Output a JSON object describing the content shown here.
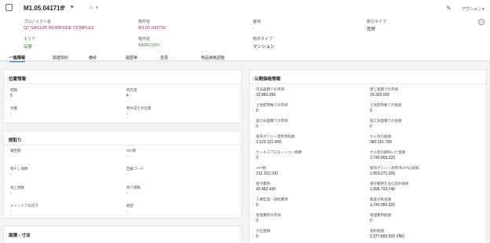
{
  "header": {
    "record_icon": "cube-icon",
    "title": "M1.05.041716",
    "favorite_icon": "star-icon",
    "flag_icon": "flag-icon",
    "tag_icon": "tag-icon",
    "tag_caret": "▾",
    "edit_icon": "pencil-icon",
    "actions_label": "アクション",
    "actions_caret": "▾",
    "feedback_icon": "smiley-icon"
  },
  "summary": {
    "project_label": "プロジェクト名",
    "project_value": "Q7 SAIGON RIVERSIDE COMPLEX",
    "unit_label": "物件名",
    "unit_value": "M1.05.041716",
    "number_label": "番地",
    "number_value": "-",
    "sale_type_label": "数引タイプ",
    "sale_type_value": "売買",
    "area_label": "エリア",
    "area_value": "高層",
    "building_label": "物件名",
    "building_value": "MERCURY",
    "property_type_label": "物件タイプ",
    "property_type_value": "マンション"
  },
  "tabs": [
    {
      "label": "一般情報",
      "active": true
    },
    {
      "label": "関連契約",
      "active": false
    },
    {
      "label": "備考",
      "active": false
    },
    {
      "label": "履歴等",
      "active": false
    },
    {
      "label": "変更",
      "active": false
    },
    {
      "label": "物品価格調整",
      "active": false
    }
  ],
  "location": {
    "title": "位置情報",
    "floor_label": "階数",
    "floor_value": "5",
    "floor_pos_label": "所在階",
    "floor_pos_value": "4",
    "lot_label": "地番",
    "lot_value": "-",
    "position_label": "物件該土の位置",
    "position_value": "-"
  },
  "layout": {
    "title": "間取り",
    "bedroom_label": "寝室数",
    "bedroom_value": "-",
    "wc_label": "WC数",
    "wc_value": "-",
    "closet_label": "物干し場数",
    "closet_value": "-",
    "balcony_label": "回廊コード",
    "balcony_value": "-",
    "above_label": "地上階数",
    "above_value": "-",
    "below_label": "地下階数",
    "below_value": "-",
    "door_label": "メインドアの向き",
    "door_value": "-",
    "view_label": "眺望",
    "view_value": "-"
  },
  "dimensions": {
    "title": "面積・寸法"
  },
  "pricing": {
    "title": "公開価格情報",
    "rows": [
      {
        "left_label": "内法面積での単価",
        "left_value": "32.883.356",
        "right_label": "建て面積での単価",
        "right_value": "29.302.000"
      },
      {
        "left_label": "土地使用権での単価",
        "left_value": "0",
        "right_label": "土地使用権での金額",
        "right_value": "0"
      },
      {
        "left_label": "施工床面積での単価",
        "left_value": "0",
        "right_label": "施工床面積での金額",
        "right_value": "0"
      },
      {
        "left_label": "販売ポリシー適用済総額",
        "left_value": "2.123.121.000",
        "right_label": "セル割引総額",
        "right_value": "382.161.780"
      },
      {
        "left_label": "セールスプロモーション総額",
        "left_value": "0",
        "right_label": "セル割引額除いた金額",
        "right_value": "1.740.959.220"
      },
      {
        "left_label": "VAT額",
        "left_value": "212.312.100",
        "right_label": "販売ポリシー適用済VAT込総額",
        "right_value": "1.953.271.320"
      },
      {
        "left_label": "保守費用",
        "left_value": "42.462.420",
        "right_label": "保守費用を含む契約価値",
        "right_value": "1.995.733.740"
      },
      {
        "left_label": "工事監理・諸経費用",
        "left_value": "0",
        "right_label": "集金対象金額",
        "right_value": "1.740.959.220"
      },
      {
        "left_label": "管理費用の単価",
        "left_value": "0",
        "right_label": "管理費用総額",
        "right_value": "0"
      },
      {
        "left_label": "引出金額",
        "left_value": "0",
        "right_label": "契約総額",
        "right_value": "2.377.895.520 VND"
      }
    ]
  }
}
